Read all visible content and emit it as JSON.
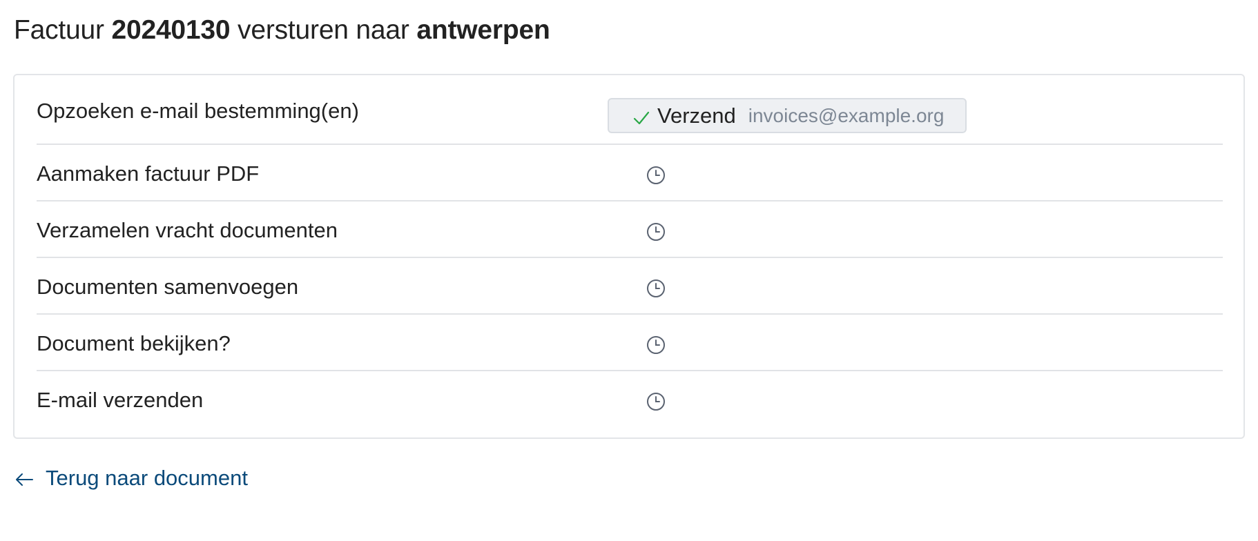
{
  "header": {
    "prefix": "Factuur",
    "invoice_number": "20240130",
    "middle": "versturen naar",
    "destination": "antwerpen"
  },
  "steps": [
    {
      "label": "Opzoeken e-mail bestemming(en)",
      "status": "done",
      "status_icon": "check-icon",
      "action": "Verzend",
      "email": "invoices@example.org"
    },
    {
      "label": "Aanmaken factuur PDF",
      "status": "pending",
      "status_icon": "clock-icon"
    },
    {
      "label": "Verzamelen vracht documenten",
      "status": "pending",
      "status_icon": "clock-icon"
    },
    {
      "label": "Documenten samenvoegen",
      "status": "pending",
      "status_icon": "clock-icon"
    },
    {
      "label": "Document bekijken?",
      "status": "pending",
      "status_icon": "clock-icon"
    },
    {
      "label": "E-mail verzenden",
      "status": "pending",
      "status_icon": "clock-icon"
    }
  ],
  "back_link": {
    "label": "Terug naar document",
    "icon": "arrow-left-icon"
  },
  "colors": {
    "link": "#0b4a7a",
    "check": "#28a745",
    "pending_icon": "#5a6270",
    "chip_bg": "#eef0f3",
    "email_text": "#7d8794"
  }
}
